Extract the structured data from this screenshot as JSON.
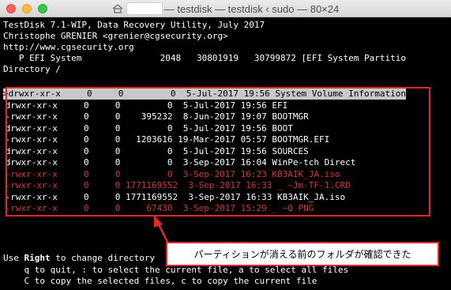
{
  "window": {
    "title_rest": "— testdisk — testdisk ‹ sudo — 80×24",
    "colors": {
      "red_annotation": "#e8272b",
      "deleted_text": "#d33a2f",
      "selection_bg": "#c8c8c8"
    }
  },
  "header": {
    "line1": "TestDisk 7.1-WIP, Data Recovery Utility, July 2017",
    "line2": "Christophe GRENIER <grenier@cgsecurity.org>",
    "line3": "http://www.cgsecurity.org",
    "line4": "   P EFI System               2048   30801919   30799872 [EFI System Partitio",
    "line5": "Directory /"
  },
  "files": [
    {
      "text": ">drwxr-xr-x     0     0         0  5-Jul-2017 19:56 System Volume Information",
      "state": "selected"
    },
    {
      "text": " drwxr-xr-x     0     0         0  5-Jul-2017 19:56 EFI",
      "state": "normal"
    },
    {
      "text": " -rwxr-xr-x     0     0    395232  8-Jun-2017 19:07 BOOTMGR",
      "state": "normal"
    },
    {
      "text": " drwxr-xr-x     0     0         0  5-Jul-2017 19:56 BOOT",
      "state": "normal"
    },
    {
      "text": " -rwxr-xr-x     0     0   1203616 19-Mar-2017 05:57 BOOTMGR.EFI",
      "state": "normal"
    },
    {
      "text": " drwxr-xr-x     0     0         0  5-Jul-2017 19:56 SOURCES",
      "state": "normal"
    },
    {
      "text": " drwxr-xr-x     0     0         0  3-Sep-2017 16:04 WinPe-tch Direct",
      "state": "normal"
    },
    {
      "text": " -rwxr-xr-x     0     0         0  3-Sep-2017 16:23 KB3AIK_JA.iso",
      "state": "deleted"
    },
    {
      "text": " -rwxr-xr-x     0     0 1771169552  3-Sep-2017 16:33 _ ~Jm-TF-1.CRD",
      "state": "deleted"
    },
    {
      "text": " -rwxr-xr-x     0     0 1771169552  3-Sep-2017 16:33 KB3AIK_JA.iso",
      "state": "normal"
    },
    {
      "text": " -rwxr-xr-x     0     0     67430  3-Sep-2017 15:29 _ ~Q PNG",
      "state": "deleted"
    }
  ],
  "footer": {
    "use": "Use ",
    "right": "Right",
    "rest1": " to change directory",
    "line2": "    q to quit, : to select the current file, a to select all files",
    "line3": "    C to copy the selected files, c to copy the current file"
  },
  "annotation": {
    "callout_text": "パーティションが消える前のフォルダが確認できた"
  }
}
